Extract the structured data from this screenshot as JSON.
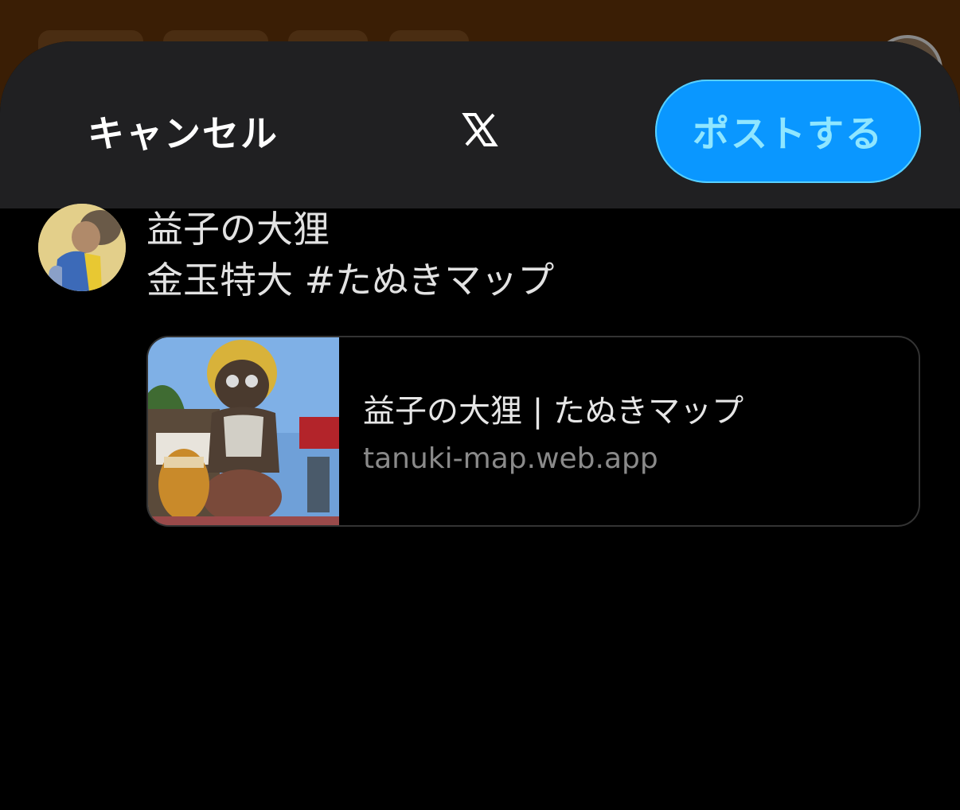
{
  "header": {
    "cancel_label": "キャンセル",
    "logo_icon": "x-logo-icon",
    "post_label": "ポストする"
  },
  "compose": {
    "text": "益子の大狸\n金玉特大 #たぬきマップ"
  },
  "link_card": {
    "title": "益子の大狸 | たぬきマップ",
    "domain": "tanuki-map.web.app"
  },
  "colors": {
    "accent": "#0a97ff",
    "header_bg": "#202022",
    "background": "#000000"
  }
}
